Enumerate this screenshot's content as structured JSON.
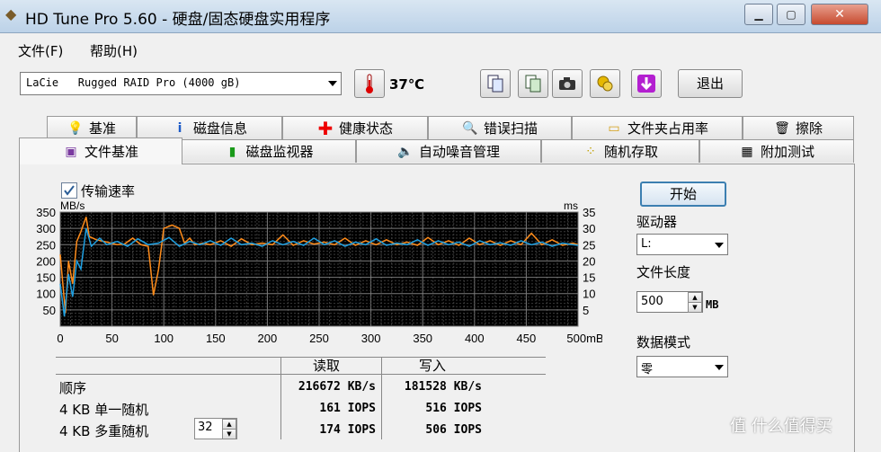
{
  "window": {
    "title": "HD Tune Pro 5.60 - 硬盘/固态硬盘实用程序"
  },
  "menu": [
    {
      "label": "文件(F)"
    },
    {
      "label": "帮助(H)"
    }
  ],
  "toolbar": {
    "drive": "LaCie   Rugged RAID Pro (4000 gB)",
    "temperature": "37℃",
    "exit_label": "退出",
    "icons": [
      "copy-text-icon",
      "copy-screen-icon",
      "camera-icon",
      "options-icon",
      "save-icon"
    ]
  },
  "tabs_row1": [
    {
      "label": "基准",
      "icon": "bulb-icon"
    },
    {
      "label": "磁盘信息",
      "icon": "info-icon"
    },
    {
      "label": "健康状态",
      "icon": "health-cross-icon"
    },
    {
      "label": "错误扫描",
      "icon": "magnifier-icon"
    },
    {
      "label": "文件夹占用率",
      "icon": "folder-icon"
    },
    {
      "label": "擦除",
      "icon": "trash-icon"
    }
  ],
  "tabs_row2": [
    {
      "label": "文件基准",
      "icon": "file-bulb-icon",
      "active": true
    },
    {
      "label": "磁盘监视器",
      "icon": "monitor-chart-icon"
    },
    {
      "label": "自动噪音管理",
      "icon": "speaker-icon"
    },
    {
      "label": "随机存取",
      "icon": "scatter-icon"
    },
    {
      "label": "附加测试",
      "icon": "calculator-icon"
    }
  ],
  "transfer_checkbox": {
    "label": "传输速率",
    "checked": true
  },
  "chart_data": {
    "type": "line",
    "xlabel": "mB",
    "ylabel_left": "MB/s",
    "ylabel_right": "ms",
    "xlim": [
      0,
      500
    ],
    "ylim_left": [
      0,
      350
    ],
    "ylim_right": [
      0,
      35
    ],
    "x_ticks": [
      "0",
      "50",
      "100",
      "150",
      "200",
      "250",
      "300",
      "350",
      "400",
      "450",
      "500mB"
    ],
    "y_ticks_left": [
      "50",
      "100",
      "150",
      "200",
      "250",
      "300",
      "350"
    ],
    "y_ticks_right": [
      "5",
      "10",
      "15",
      "20",
      "25",
      "30",
      "35"
    ],
    "grid": true,
    "background": "#000000",
    "series": [
      {
        "color": "#ff8c1a",
        "x": [
          0,
          5,
          8,
          12,
          16,
          20,
          25,
          28,
          35,
          45,
          55,
          62,
          70,
          78,
          85,
          90,
          95,
          100,
          108,
          115,
          120,
          125,
          130,
          138,
          145,
          155,
          165,
          175,
          185,
          195,
          205,
          215,
          225,
          235,
          245,
          255,
          265,
          275,
          285,
          295,
          305,
          315,
          325,
          335,
          345,
          355,
          365,
          375,
          385,
          395,
          405,
          415,
          425,
          435,
          445,
          455,
          465,
          475,
          485,
          495,
          500
        ],
        "y": [
          220,
          40,
          200,
          130,
          260,
          290,
          335,
          275,
          265,
          258,
          250,
          252,
          270,
          250,
          245,
          95,
          175,
          300,
          310,
          300,
          255,
          270,
          250,
          255,
          250,
          262,
          245,
          268,
          250,
          255,
          250,
          280,
          248,
          262,
          252,
          258,
          250,
          270,
          248,
          262,
          250,
          265,
          250,
          258,
          248,
          272,
          250,
          262,
          248,
          270,
          250,
          262,
          248,
          262,
          250,
          285,
          250,
          265,
          248,
          255,
          250
        ]
      },
      {
        "color": "#1f9fe0",
        "x": [
          0,
          4,
          8,
          12,
          16,
          20,
          25,
          30,
          38,
          45,
          55,
          65,
          75,
          85,
          95,
          105,
          115,
          125,
          135,
          145,
          155,
          165,
          175,
          185,
          195,
          205,
          215,
          225,
          235,
          245,
          255,
          265,
          275,
          285,
          295,
          305,
          315,
          325,
          335,
          345,
          355,
          365,
          375,
          385,
          395,
          405,
          415,
          425,
          435,
          445,
          455,
          465,
          475,
          485,
          495,
          500
        ],
        "y": [
          130,
          30,
          160,
          90,
          200,
          175,
          300,
          245,
          270,
          250,
          260,
          245,
          268,
          250,
          255,
          272,
          245,
          260,
          250,
          262,
          248,
          270,
          250,
          255,
          245,
          262,
          250,
          260,
          248,
          270,
          250,
          262,
          245,
          258,
          250,
          268,
          248,
          255,
          250,
          265,
          248,
          262,
          250,
          258,
          245,
          262,
          250,
          256,
          248,
          262,
          250,
          258,
          245,
          255,
          250,
          248
        ]
      }
    ]
  },
  "results": {
    "col_read": "读取",
    "col_write": "写入",
    "rows": [
      {
        "label": "顺序",
        "read": "216672 KB/s",
        "write": "181528 KB/s"
      },
      {
        "label": "4 KB 单一随机",
        "read": "161 IOPS",
        "write": "516 IOPS"
      },
      {
        "label": "4 KB 多重随机",
        "read": "174 IOPS",
        "write": "506 IOPS"
      }
    ],
    "queue_depth": "32"
  },
  "side": {
    "start_label": "开始",
    "drive_label": "驱动器",
    "drive_value": "L:",
    "file_length_label": "文件长度",
    "file_length_value": "500",
    "file_length_unit": "MB",
    "data_mode_label": "数据模式",
    "data_mode_value": "零"
  },
  "watermark": "值 什么值得买"
}
